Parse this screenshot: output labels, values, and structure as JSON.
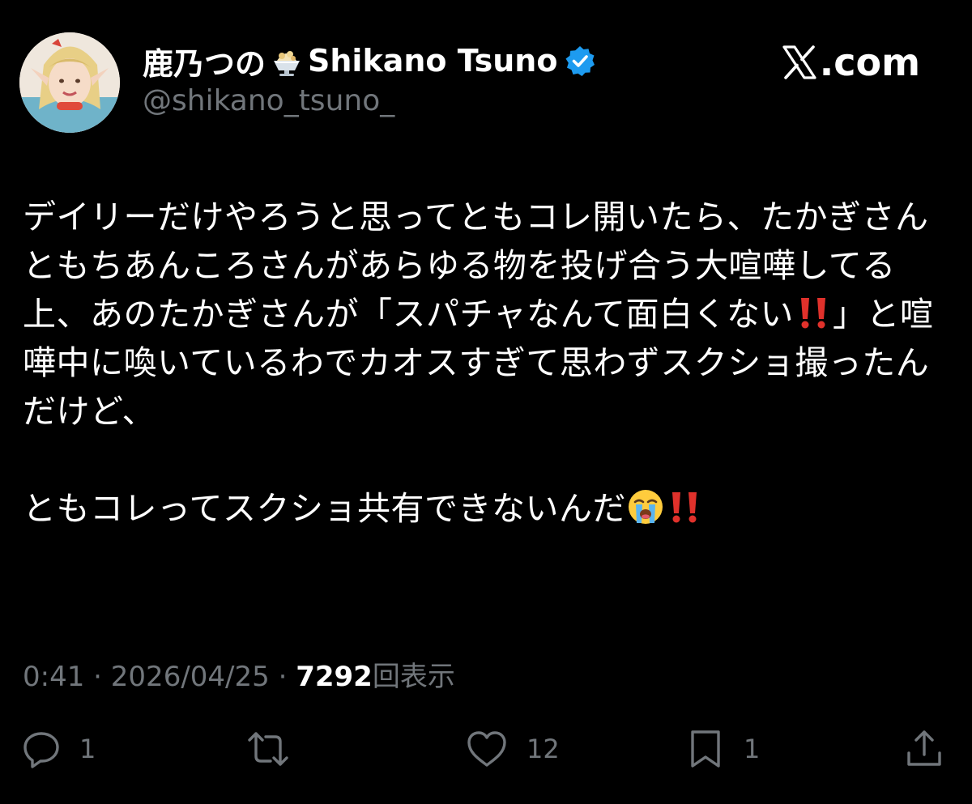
{
  "author": {
    "display_name": "鹿乃つの",
    "display_name_suffix": "Shikano Tsuno",
    "handle": "@shikano_tsuno_",
    "name_emoji": "shaved-ice-icon",
    "verified_icon": "verified-badge-icon"
  },
  "brand": {
    "label": ".com",
    "logo": "x-logo-icon"
  },
  "tweet": {
    "paragraph_1_part_1": "デイリーだけやろうと思ってともコレ開いたら、たかぎさんともちあんころさんがあらゆる物を投げ合う大喧嘩してる上、あのたかぎさんが「スパチャなんて面白くない",
    "paragraph_1_emoji": "double-exclamation-icon",
    "paragraph_1_part_2": "」と喧嘩中に喚いているわでカオスすぎて思わずスクショ撮ったんだけど、",
    "paragraph_2": "ともコレってスクショ共有できないんだ",
    "paragraph_2_emojis": [
      "loudly-crying-face-icon",
      "double-exclamation-icon"
    ]
  },
  "meta": {
    "time": "0:41",
    "separator": "·",
    "date": "2026/04/25",
    "views": "7292",
    "views_label": "回表示"
  },
  "actions": {
    "reply_count": "1",
    "repost_count": "",
    "like_count": "12",
    "bookmark_count": "1",
    "icons": [
      "reply-icon",
      "repost-icon",
      "like-icon",
      "bookmark-icon",
      "share-icon"
    ]
  },
  "colors": {
    "background": "#000000",
    "text": "#ffffff",
    "muted": "#71767b",
    "verified": "#1d9bf0",
    "exclamation": "#e0312b"
  }
}
